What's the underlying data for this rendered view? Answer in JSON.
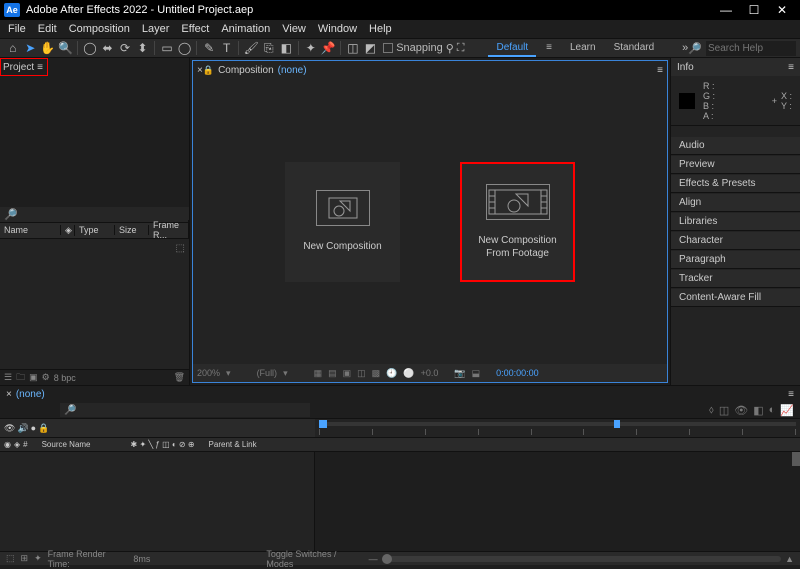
{
  "title_bar": {
    "app_badge": "Ae",
    "title": "Adobe After Effects 2022 - Untitled Project.aep",
    "min": "—",
    "max": "☐",
    "close": "✕"
  },
  "menu": [
    "File",
    "Edit",
    "Composition",
    "Layer",
    "Effect",
    "Animation",
    "View",
    "Window",
    "Help"
  ],
  "toolbar": {
    "snapping_label": "Snapping",
    "workspaces": [
      "Default",
      "Learn",
      "Standard"
    ],
    "more": "»",
    "search_placeholder": "Search Help"
  },
  "project_panel": {
    "tab": "Project",
    "columns": {
      "name": "Name",
      "type": "Type",
      "size": "Size",
      "frame": "Frame R..."
    },
    "footer_bpc": "8 bpc"
  },
  "composition_panel": {
    "tab": "Composition",
    "none": "(none)",
    "new_comp": "New Composition",
    "new_from_footage_l1": "New Composition",
    "new_from_footage_l2": "From Footage",
    "zoom": "200%",
    "res": "(Full)",
    "exposure": "+0.0",
    "timecode": "0:00:00:00"
  },
  "right_panel": {
    "info_tab": "Info",
    "rgb": {
      "r": "R :",
      "g": "G :",
      "b": "B :",
      "a": "A :"
    },
    "xy": {
      "x": "X :",
      "y": "Y :"
    },
    "sections": [
      "Audio",
      "Preview",
      "Effects & Presets",
      "Align",
      "Libraries",
      "Character",
      "Paragraph",
      "Tracker",
      "Content-Aware Fill"
    ]
  },
  "timeline": {
    "tab_none": "(none)",
    "col_source": "Source Name",
    "col_parent": "Parent & Link",
    "render_label": "Frame Render Time:",
    "render_value": "8ms",
    "toggle": "Toggle Switches / Modes"
  }
}
